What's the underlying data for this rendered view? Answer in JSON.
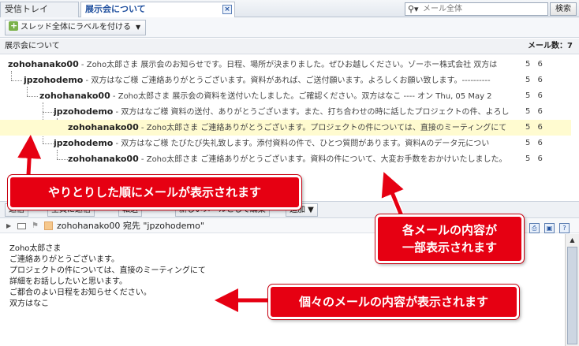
{
  "tabs": {
    "inbox": "受信トレイ",
    "active": "展示会について",
    "close_glyph": "×"
  },
  "search": {
    "placeholder": "メール全体",
    "button": "検索"
  },
  "toolbar": {
    "label_button": "スレッド全体にラベルを付ける"
  },
  "thread_header": {
    "subject": "展示会について",
    "count_label": "メール数：",
    "count": "7"
  },
  "rows": [
    {
      "sender": "zohohanako00",
      "snippet": " - Zoho太郎さま 展示会のお知らせです。日程、場所が決まりました。ぜひお越しください。ゾーホー株式会社 双方は",
      "num": "5 6"
    },
    {
      "sender": "jpzohodemo",
      "snippet": " - 双方はなご様 ご連絡ありがとうございます。資料があれば、ご送付願います。よろしくお願い致します。----------",
      "num": "5 6"
    },
    {
      "sender": "zohohanako00",
      "snippet": " - Zoho太郎さま 展示会の資料を送付いたしました。ご確認ください。双方はなこ ---- オン Thu, 05 May 2",
      "num": "5 6"
    },
    {
      "sender": "jpzohodemo",
      "snippet": " - 双方はなご様 資料の送付、ありがとうございます。また、打ち合わせの時に話したプロジェクトの件、よろし",
      "num": "5 6"
    },
    {
      "sender": "zohohanako00",
      "snippet": " - Zoho太郎さま ご連絡ありがとうございます。プロジェクトの件については、直接のミーティングにて",
      "num": "5 6"
    },
    {
      "sender": "jpzohodemo",
      "snippet": " - 双方はなご様 たびたび失礼致します。添付資料の件で、ひとつ質問があります。資料Aのデータ元につい",
      "num": "5 6"
    },
    {
      "sender": "zohohanako00",
      "snippet": " - Zoho太郎さま ご連絡ありがとうございます。資料の件について、大変お手数をおかけいたしました。",
      "num": "5 6"
    }
  ],
  "toolbar2": {
    "b1": "返信",
    "b2": "全員に返信",
    "b3": "転送",
    "b4": "新しいメールとして編集",
    "b5": "追加"
  },
  "message": {
    "from": "zohohanako00",
    "to_label": " 宛先 ",
    "to": "\"jpzohodemo\"",
    "body": [
      "Zoho太郎さま",
      "",
      "ご連絡ありがとうございます。",
      "プロジェクトの件については、直接のミーティングにて",
      "詳細をお話ししたいと思います。",
      "",
      "ご都合のよい日程をお知らせください。",
      "",
      "双方はなこ"
    ]
  },
  "callouts": {
    "order": "やりとりした順にメールが表示されます",
    "partial_1": "各メールの内容が",
    "partial_2": "一部表示されます",
    "content": "個々のメールの内容が表示されます"
  },
  "colors": {
    "callout": "#e60012",
    "selected_row": "#fffbd0",
    "active_tab_text": "#1f4f9e"
  }
}
